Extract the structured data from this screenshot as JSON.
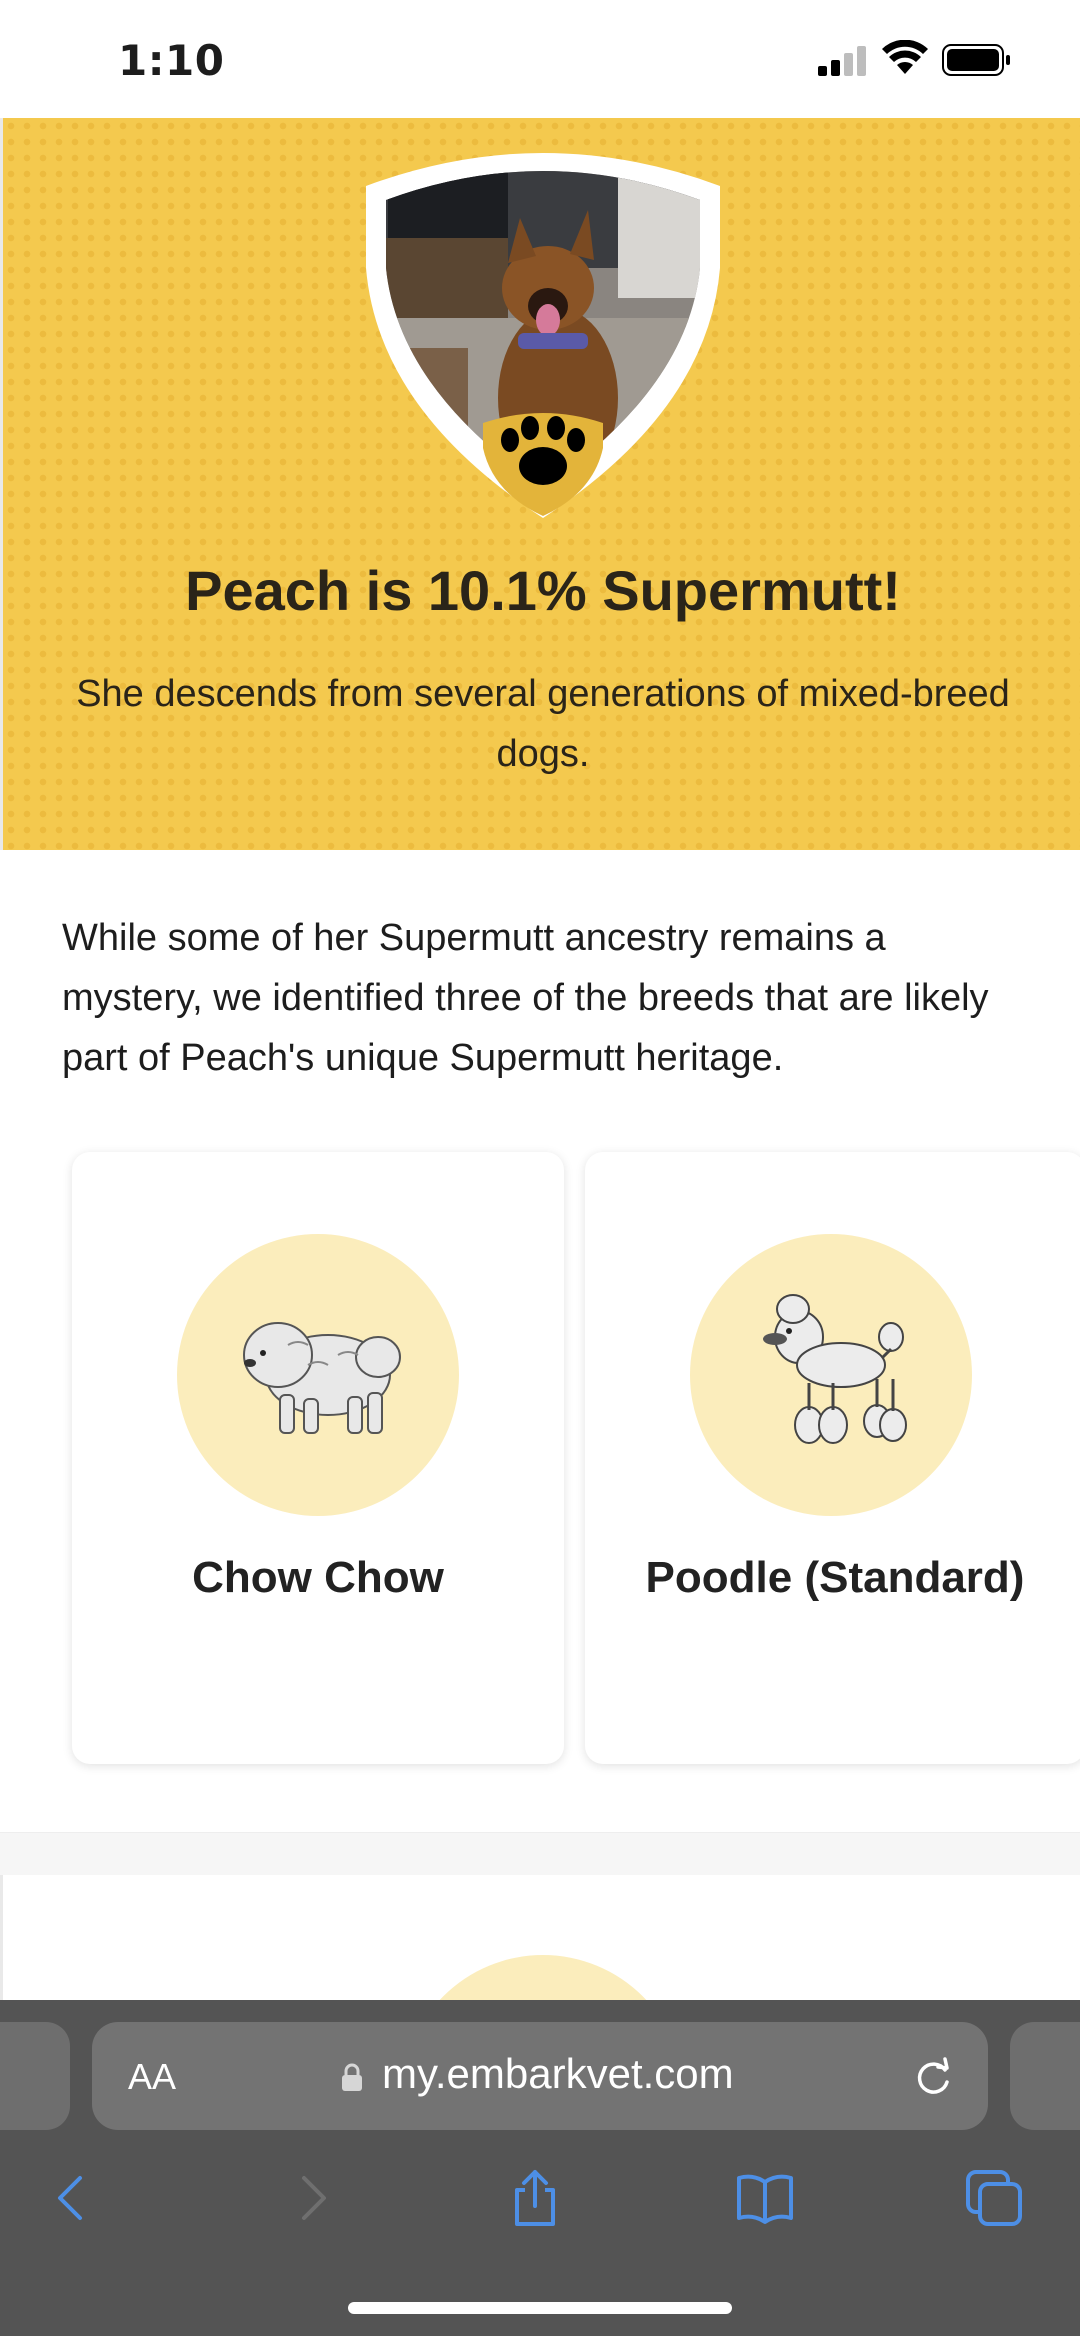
{
  "status_bar": {
    "time": "1:10",
    "icons": [
      "signal-icon",
      "wifi-icon",
      "battery-icon"
    ]
  },
  "hero": {
    "title": "Peach is 10.1% Supermutt!",
    "subtitle": "She descends from several generations of mixed-breed dogs.",
    "badge_icon": "paw-icon",
    "background_color": "#f4c94e"
  },
  "intro": "While some of her Supermutt ancestry remains a mystery, we identified three of the breeds that are likely part of Peach's unique Supermutt heritage.",
  "breeds": [
    {
      "name": "Chow Chow",
      "image": "chow-chow-illustration"
    },
    {
      "name": "Poodle (Standard)",
      "image": "poodle-illustration"
    }
  ],
  "browser": {
    "text_size_label": "AA",
    "url": "my.embarkvet.com",
    "toolbar": [
      "back-icon",
      "forward-icon",
      "share-icon",
      "bookmarks-icon",
      "tabs-icon"
    ],
    "accent_color": "#4d8fe6"
  }
}
